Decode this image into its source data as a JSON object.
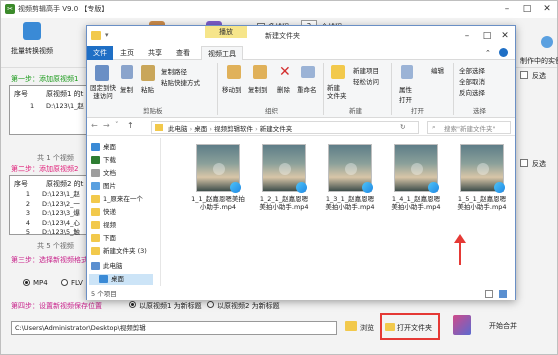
{
  "app": {
    "title": "视频剪辑高手 V9.0 【专版】",
    "toolbar": {
      "batch_merge": "批量转换视频",
      "multithread_label": "多线程",
      "thread_count": "2",
      "thread_suffix": "个线程",
      "example_link": "制作中的实例"
    },
    "step1": "第一步：添加原视频1",
    "grid1": {
      "headers": [
        "序号",
        "原视频1 的t"
      ],
      "rows": [
        [
          "1",
          "D:\\123\\1_赵"
        ]
      ],
      "count": "共 1 个视频"
    },
    "step2": "第二步：添加原视频2",
    "grid2": {
      "headers": [
        "序号",
        "原视频2 的t"
      ],
      "rows": [
        [
          "1",
          "D:\\123\\1_赵"
        ],
        [
          "2",
          "D:\\123\\2_一"
        ],
        [
          "3",
          "D:\\123\\3_爆"
        ],
        [
          "4",
          "D:\\123\\4_心"
        ],
        [
          "5",
          "D:\\123\\5_触"
        ]
      ],
      "count": "共 5 个视频"
    },
    "step3": "第三步：选择新视频格式",
    "formats": [
      "MP4",
      "FLV"
    ],
    "right_panel": {
      "select_all": "全部选中",
      "deselect_all": "全部取消",
      "invert": "反选",
      "add_dir_label": "反选"
    },
    "step4": "第四步：设置新视频保存位置",
    "naming_options": [
      "以原视频1 为新标题",
      "以原视频2 为新标题"
    ],
    "save_path": "C:\\Users\\Administrator\\Desktop\\视频剪辑",
    "browse": "浏览",
    "open_folder": "打开文件夹",
    "start_merge": "开始合并"
  },
  "explorer": {
    "manage_tab": "播放",
    "title": "新建文件夹",
    "tabs": [
      "文件",
      "主页",
      "共享",
      "查看",
      "视频工具"
    ],
    "ribbon": {
      "pin": "固定到快速访问",
      "copy": "复制",
      "paste": "粘贴",
      "copy_path": "复制路径",
      "paste_shortcut": "粘贴快捷方式",
      "clipboard": "剪贴板",
      "move_to": "移动到",
      "copy_to": "复制到",
      "delete": "删除",
      "rename": "重命名",
      "organize": "组织",
      "new_folder": "新建\n文件夹",
      "new_item": "新建项目",
      "easy_access": "轻松访问",
      "new_group": "新建",
      "properties": "属性",
      "open": "打开",
      "edit": "编辑",
      "history": "历史记录",
      "open_group": "打开",
      "select_all": "全部选择",
      "select_none": "全部取消",
      "invert": "反向选择",
      "select_group": "选择"
    },
    "breadcrumb": [
      "此电脑",
      "桌面",
      "视频剪辑软件",
      "新建文件夹"
    ],
    "search_placeholder": "搜索\"新建文件夹\"",
    "nav": [
      "桌面",
      "下载",
      "文档",
      "图片",
      "1_原来在一个",
      "快递",
      "视频",
      "下面",
      "新建文件夹 (3)",
      "此电脑",
      "桌面"
    ],
    "files": [
      "1_1_赵嘉恩嗯美拍小助手.mp4",
      "1_2_1_赵嘉恩嗯美拍小助手.mp4",
      "1_3_1_赵嘉恩嗯美拍小助手.mp4",
      "1_4_1_赵嘉恩嗯美拍小助手.mp4",
      "1_5_1_赵嘉恩嗯美拍小助手.mp4"
    ],
    "status": "5 个项目"
  },
  "colors": {
    "step_green": "#1a9a1a",
    "step_pink": "#e0207a",
    "step_magenta": "#c8208a",
    "highlight_red": "#e53935",
    "explorer_blue": "#1f6fc5"
  }
}
